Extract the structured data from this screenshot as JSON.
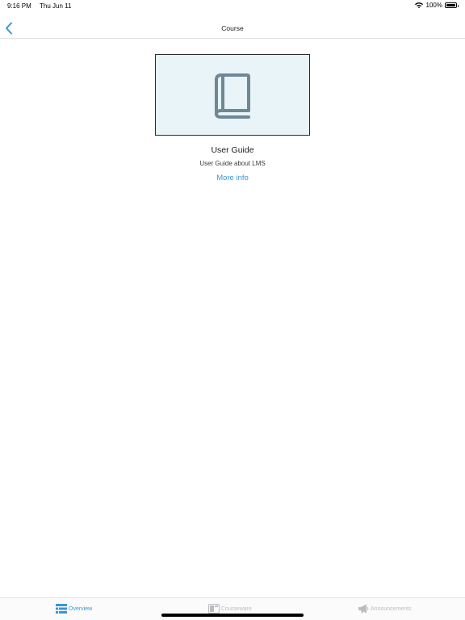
{
  "status_bar": {
    "time": "9:16 PM",
    "date": "Thu Jun 11",
    "battery": "100%",
    "battery_level": 1.0,
    "wifi_icon": "wifi-icon"
  },
  "nav": {
    "title": "Course",
    "back_icon": "chevron-left-icon"
  },
  "course": {
    "image_icon": "book-icon",
    "title": "User Guide",
    "description": "User Guide about LMS",
    "more_info": "More info"
  },
  "tabs": [
    {
      "label": "Overview",
      "icon": "list-icon",
      "active": true
    },
    {
      "label": "Courseware",
      "icon": "courseware-icon",
      "active": false
    },
    {
      "label": "Announcements",
      "icon": "megaphone-icon",
      "active": false
    }
  ],
  "colors": {
    "accent": "#3b96d2",
    "inactive": "#b9bcc1",
    "image_bg": "#e8f4f8",
    "book_icon": "#6e8896"
  }
}
